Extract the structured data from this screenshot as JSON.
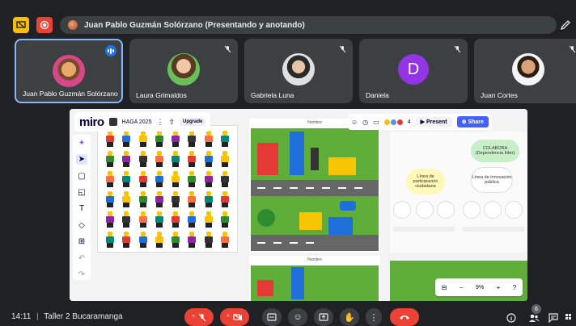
{
  "top": {
    "presenter_label": "Juan Pablo Guzmán Solórzano (Presentando y anotando)"
  },
  "participants": [
    {
      "name": "Juan Pablo Guzmán Solórzano",
      "speaking": true
    },
    {
      "name": "Laura Grimaldos",
      "muted": true
    },
    {
      "name": "Gabriela Luna",
      "muted": true
    },
    {
      "name": "Daniela",
      "muted": true,
      "initial": "D",
      "avatar_color": "#9334e6"
    },
    {
      "name": "Juan Cortes",
      "muted": true
    }
  ],
  "miro": {
    "logo": "miro",
    "board_name": "HAGA 2025",
    "upgrade_label": "Upgrade",
    "present_label": "Present",
    "share_label": "Share",
    "collaborators_count": "4",
    "zoom_level": "9%",
    "frame_label_1": "Nombre",
    "frame_label_2": "Nombre",
    "mind_map": {
      "central": "COLABORA (Dependencia líder)",
      "left_node": "Línea de participación ciudadana",
      "right_node": "Línea de innovación pública"
    }
  },
  "bottom": {
    "time": "14:11",
    "separator": "|",
    "meeting_name": "Taller 2 Bucaramanga",
    "participants_count": "6"
  },
  "colors": {
    "bg": "#202124",
    "tile": "#3c4043",
    "accent": "#8ab4f8",
    "danger": "#ea4335",
    "miro_share": "#4262ff"
  }
}
